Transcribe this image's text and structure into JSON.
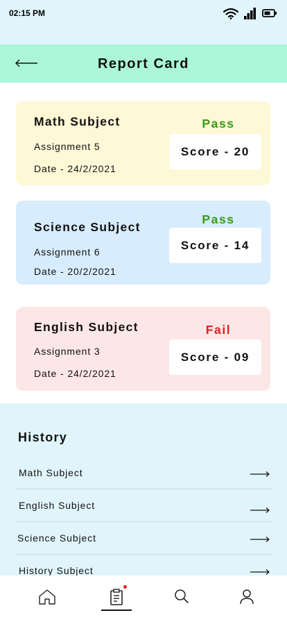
{
  "status_bar": {
    "time": "02:15 PM"
  },
  "header": {
    "title": "Report Card"
  },
  "cards": [
    {
      "subject": "Math Subject",
      "assignment": "Assignment 5",
      "date": "Date - 24/2/2021",
      "status": "Pass",
      "score": "Score - 20",
      "bg_color": "#fff8d6",
      "status_color": "#3a9a1a"
    },
    {
      "subject": "Science Subject",
      "assignment": "Assignment 6",
      "date": "Date - 20/2/2021",
      "status": "Pass",
      "score": "Score - 14",
      "bg_color": "#d7ecfd",
      "status_color": "#3a9a1a"
    },
    {
      "subject": "English Subject",
      "assignment": "Assignment 3",
      "date": "Date - 24/2/2021",
      "status": "Fail",
      "score": "Score - 09",
      "bg_color": "#fde6e6",
      "status_color": "#e02020"
    }
  ],
  "history": {
    "title": "History",
    "items": [
      {
        "label": "Math Subject"
      },
      {
        "label": "English Subject"
      },
      {
        "label": "Science Subject"
      },
      {
        "label": "History Subject"
      }
    ]
  },
  "bottom_nav": {
    "items": [
      {
        "icon": "home-icon",
        "active": false
      },
      {
        "icon": "report-icon",
        "active": true,
        "badge_color": "#e02020"
      },
      {
        "icon": "search-icon",
        "active": false
      },
      {
        "icon": "profile-icon",
        "active": false
      }
    ]
  },
  "colors": {
    "header_bg": "#abf6d8",
    "page_bg": "#e0f5fb",
    "pass": "#3a9a1a",
    "fail": "#e02020"
  }
}
